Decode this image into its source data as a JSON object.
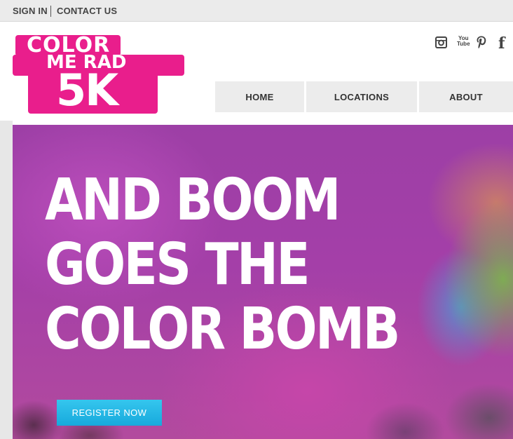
{
  "topbar": {
    "sign_in": "SIGN IN",
    "contact_us": "CONTACT US"
  },
  "logo": {
    "line1": "COLOR",
    "line2": "ME RAD",
    "line3": "5K",
    "brand_color": "#e91e8c"
  },
  "social": {
    "instagram_icon": "instagram-icon",
    "youtube_top": "You",
    "youtube_bottom": "Tube",
    "pinterest_icon": "pinterest-icon",
    "facebook_label": "f"
  },
  "nav": {
    "items": [
      {
        "label": "HOME"
      },
      {
        "label": "LOCATIONS"
      },
      {
        "label": "ABOUT"
      }
    ]
  },
  "hero": {
    "headline_lines": [
      "AND BOOM",
      "GOES THE",
      "COLOR BOMB"
    ],
    "cta_label": "REGISTER NOW",
    "cta_color": "#1fb2e2"
  }
}
